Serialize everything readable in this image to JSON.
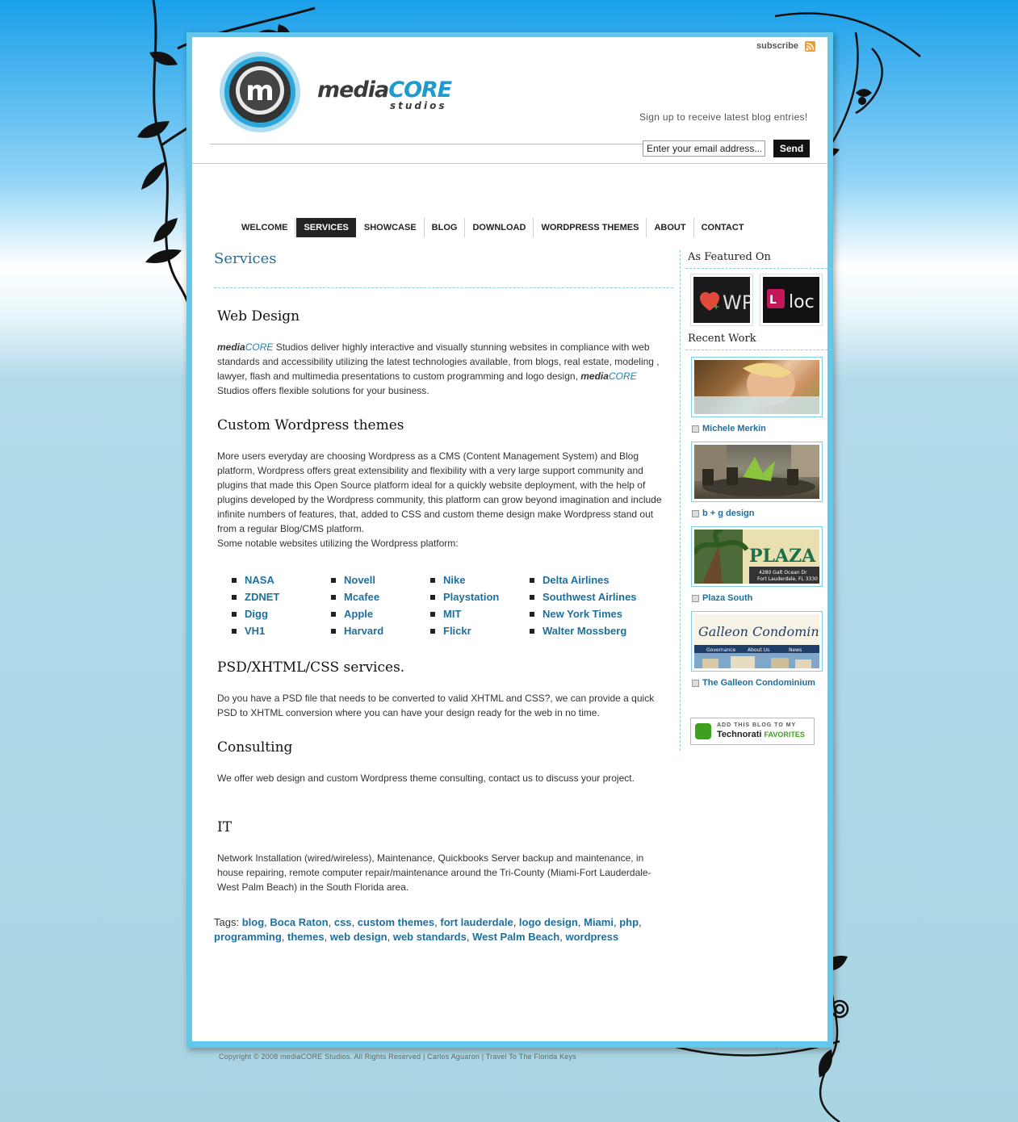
{
  "header": {
    "logo_main": "media",
    "logo_core": "CORE",
    "logo_sub": "studios",
    "subscribe": "subscribe",
    "signup_text": "Sign up to receive latest blog entries!",
    "email_value": "Enter your email address...",
    "send_label": "Send"
  },
  "nav": [
    "WELCOME",
    "SERVICES",
    "SHOWCASE",
    "BLOG",
    "DOWNLOAD",
    "WORDPRESS THEMES",
    "ABOUT",
    "CONTACT"
  ],
  "nav_active": "SERVICES",
  "main": {
    "title": "Services",
    "web_design": {
      "heading": "Web Design",
      "brand_a": "media",
      "brand_b": "CORE",
      "text1": " Studios deliver highly interactive and visually stunning websites in compliance with web standards and accessibility utilizing the latest technologies available, from blogs, real estate, modeling , lawyer, flash and multimedia presentations to custom programming and logo design, ",
      "text2": " Studios offers flexible solutions for your business."
    },
    "wordpress": {
      "heading": "Custom Wordpress themes",
      "text": "More users everyday are choosing Wordpress as a CMS (Content Management System) and Blog platform, Wordpress offers great extensibility and flexibility with a very large support community and plugins that made this Open Source platform ideal for a quickly website deployment, with the help of plugins developed by the Wordpress community, this platform can grow beyond imagination and include infinite numbers of features, that, added to CSS and custom theme design make Wordpress stand out from a regular Blog/CMS platform.",
      "text2": "Some notable websites utilizing the Wordpress platform:",
      "sites": [
        "NASA",
        "Novell",
        "Nike",
        "Delta Airlines",
        "ZDNET",
        "Mcafee",
        "Playstation",
        "Southwest Airlines",
        "Digg",
        "Apple",
        "MIT",
        "New York Times",
        "VH1",
        "Harvard",
        "Flickr",
        "Walter Mossberg"
      ]
    },
    "psd": {
      "heading": "PSD/XHTML/CSS services.",
      "text": "Do you have a PSD file that needs to be converted to valid XHTML and CSS?, we can provide a quick PSD to XHTML conversion where you can have your design ready for the web in no time."
    },
    "consulting": {
      "heading": "Consulting",
      "text": "We offer web design and custom Wordpress theme consulting, contact us to discuss your project."
    },
    "it": {
      "heading": "IT",
      "text": "Network Installation (wired/wireless), Maintenance, Quickbooks Server backup and maintenance, in house repairing, remote computer repair/maintenance around the Tri-County (Miami-Fort Lauderdale-West Palm Beach) in the South Florida area."
    },
    "tags_label": "Tags:",
    "tags": [
      "blog",
      "Boca Raton",
      "css",
      "custom themes",
      "fort lauderdale",
      "logo design",
      "Miami",
      "php",
      "programming",
      "themes",
      "web design",
      "web standards",
      "West Palm Beach",
      "wordpress"
    ]
  },
  "sidebar": {
    "featured_title": "As Featured On",
    "featured": [
      "WP",
      "loc"
    ],
    "recent_title": "Recent Work",
    "works": [
      "Michele Merkin",
      "b + g design",
      "Plaza South",
      "The Galleon Condominium"
    ],
    "plaza_sign": "PLAZA",
    "plaza_addr": "4280 Galt Ocean Dr",
    "plaza_city": "Fort Lauderdale, FL 3330",
    "galleon_title": "Galleon Condominium",
    "galleon_nav": [
      "Governance",
      "About Us",
      "News"
    ],
    "technorati_line1": "ADD THIS BLOG TO MY",
    "technorati_line2": "Technorati",
    "technorati_line3": "FAVORITES"
  },
  "footer": "Copyright © 2008 mediaCORE Studios. All Rights Reserved | Carlos Aguaron | Travel To The Florida Keys",
  "colors": {
    "accent": "#1f6f9d",
    "frame": "#5fc8ec",
    "nav_active": "#222222"
  }
}
